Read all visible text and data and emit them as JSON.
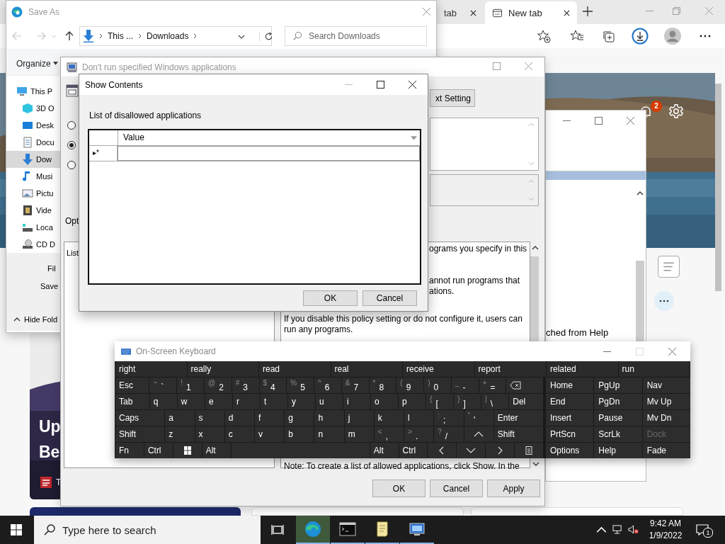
{
  "browser": {
    "tabs": [
      {
        "label": "tab",
        "selected": false
      },
      {
        "label": "New tab",
        "selected": true
      }
    ],
    "notification_count": "2",
    "headline_lines": [
      "Up",
      "Be"
    ],
    "source_letter": "T"
  },
  "help_window": {
    "text": "ched from Help"
  },
  "save_as": {
    "title": "Save As",
    "path": [
      "This ...",
      "Downloads"
    ],
    "search": {
      "placeholder": "Search Downloads"
    },
    "organize": "Organize",
    "nav_items": [
      {
        "label": "This P",
        "kind": "pc",
        "selected": false,
        "children": [
          {
            "label": "3D O",
            "kind": "objects",
            "selected": false
          },
          {
            "label": "Desk",
            "kind": "desktop",
            "selected": false
          },
          {
            "label": "Docu",
            "kind": "documents",
            "selected": false
          },
          {
            "label": "Dow",
            "kind": "downloads",
            "selected": true
          },
          {
            "label": "Musi",
            "kind": "music",
            "selected": false
          },
          {
            "label": "Pictu",
            "kind": "pictures",
            "selected": false
          },
          {
            "label": "Vide",
            "kind": "videos",
            "selected": false
          },
          {
            "label": "Loca",
            "kind": "disk",
            "selected": false
          },
          {
            "label": "CD D",
            "kind": "cd",
            "selected": false
          }
        ]
      }
    ],
    "file_name_label": "Fil",
    "save_type_label": "Save",
    "hide_folders": "Hide Fold"
  },
  "policy": {
    "title": "Don't run specified Windows applications",
    "next_button": "xt Setting",
    "options": [
      {
        "selected": false
      },
      {
        "selected": true
      },
      {
        "selected": false
      }
    ],
    "options_label": "Opt",
    "list_label": "List",
    "help_lines": [
      {
        "kind": "fragment",
        "text": "ograms you specify in this"
      },
      {
        "kind": "fragment",
        "text": "annot run programs that"
      },
      {
        "kind": "fragment",
        "text": "ations."
      },
      {
        "kind": "line",
        "text": "If you disable this policy setting or do not configure it, users can"
      },
      {
        "kind": "line",
        "text": "run any programs."
      },
      {
        "kind": "line",
        "text": "Note: To create a list of allowed applications, click Show.  In the"
      }
    ],
    "buttons": [
      "OK",
      "Cancel",
      "Apply"
    ]
  },
  "show_contents": {
    "title": "Show Contents",
    "label": "List of disallowed applications",
    "column": "Value",
    "new_row_marker": "▸*",
    "buttons": [
      "OK",
      "Cancel"
    ]
  },
  "keyboard": {
    "title": "On-Screen Keyboard",
    "predictions": [
      "right",
      "really",
      "read",
      "real",
      "receive",
      "report",
      "related",
      "run"
    ],
    "rows": [
      [
        {
          "kind": "wide",
          "label": "Esc"
        },
        {
          "kind": "key",
          "top": "~",
          "label": "`"
        },
        {
          "kind": "key",
          "top": "!",
          "label": "1"
        },
        {
          "kind": "key",
          "top": "@",
          "label": "2"
        },
        {
          "kind": "key",
          "top": "#",
          "label": "3"
        },
        {
          "kind": "key",
          "top": "$",
          "label": "4"
        },
        {
          "kind": "key",
          "top": "%",
          "label": "5"
        },
        {
          "kind": "key",
          "top": "^",
          "label": "6"
        },
        {
          "kind": "key",
          "top": "&",
          "label": "7"
        },
        {
          "kind": "key",
          "top": "*",
          "label": "8"
        },
        {
          "kind": "key",
          "top": "(",
          "label": "9"
        },
        {
          "kind": "key",
          "top": ")",
          "label": "0"
        },
        {
          "kind": "key",
          "top": "_",
          "label": "-"
        },
        {
          "kind": "key",
          "top": "+",
          "label": "="
        },
        {
          "kind": "backspace"
        }
      ],
      [
        {
          "kind": "wide",
          "label": "Tab"
        },
        {
          "kind": "key",
          "label": "q"
        },
        {
          "kind": "key",
          "label": "w"
        },
        {
          "kind": "key",
          "label": "e"
        },
        {
          "kind": "key",
          "label": "r"
        },
        {
          "kind": "key",
          "label": "t"
        },
        {
          "kind": "key",
          "label": "y"
        },
        {
          "kind": "key",
          "label": "u"
        },
        {
          "kind": "key",
          "label": "i"
        },
        {
          "kind": "key",
          "label": "o"
        },
        {
          "kind": "key",
          "label": "p"
        },
        {
          "kind": "key",
          "top": "{",
          "label": "["
        },
        {
          "kind": "key",
          "top": "}",
          "label": "]"
        },
        {
          "kind": "key",
          "top": "|",
          "label": "\\"
        },
        {
          "kind": "wide",
          "label": "Del"
        }
      ],
      [
        {
          "kind": "xwide",
          "label": "Caps"
        },
        {
          "kind": "key",
          "label": "a"
        },
        {
          "kind": "key",
          "label": "s"
        },
        {
          "kind": "key",
          "label": "d"
        },
        {
          "kind": "key",
          "label": "f"
        },
        {
          "kind": "key",
          "label": "g"
        },
        {
          "kind": "key",
          "label": "h"
        },
        {
          "kind": "key",
          "label": "j"
        },
        {
          "kind": "key",
          "label": "k"
        },
        {
          "kind": "key",
          "label": "l"
        },
        {
          "kind": "key",
          "top": ":",
          "label": ";"
        },
        {
          "kind": "key",
          "top": "\"",
          "label": "'"
        },
        {
          "kind": "xwide",
          "label": "Enter"
        }
      ],
      [
        {
          "kind": "xwide",
          "label": "Shift"
        },
        {
          "kind": "key",
          "label": "z"
        },
        {
          "kind": "key",
          "label": "x"
        },
        {
          "kind": "key",
          "label": "c"
        },
        {
          "kind": "key",
          "label": "v"
        },
        {
          "kind": "key",
          "label": "b"
        },
        {
          "kind": "key",
          "label": "n"
        },
        {
          "kind": "key",
          "label": "m"
        },
        {
          "kind": "key",
          "top": "<",
          "label": ","
        },
        {
          "kind": "key",
          "top": ">",
          "label": "."
        },
        {
          "kind": "key",
          "top": "?",
          "label": "/"
        },
        {
          "kind": "up"
        },
        {
          "kind": "xwide",
          "label": "Shift"
        }
      ],
      [
        {
          "kind": "key",
          "label": "Fn"
        },
        {
          "kind": "key",
          "label": "Ctrl"
        },
        {
          "kind": "windows"
        },
        {
          "kind": "key",
          "label": "Alt"
        },
        {
          "kind": "space"
        },
        {
          "kind": "key",
          "label": "Alt"
        },
        {
          "kind": "key",
          "label": "Ctrl"
        },
        {
          "kind": "left"
        },
        {
          "kind": "down"
        },
        {
          "kind": "right"
        },
        {
          "kind": "menu"
        }
      ]
    ],
    "nav_keys": [
      {
        "label": "Home",
        "disabled": false
      },
      {
        "label": "PgUp",
        "disabled": false
      },
      {
        "label": "Nav",
        "disabled": false
      },
      {
        "label": "End",
        "disabled": false
      },
      {
        "label": "PgDn",
        "disabled": false
      },
      {
        "label": "Mv Up",
        "disabled": false
      },
      {
        "label": "Insert",
        "disabled": false
      },
      {
        "label": "Pause",
        "disabled": false
      },
      {
        "label": "Mv Dn",
        "disabled": false
      },
      {
        "label": "PrtScn",
        "disabled": false
      },
      {
        "label": "ScrLk",
        "disabled": false
      },
      {
        "label": "Dock",
        "disabled": true
      },
      {
        "label": "Options",
        "disabled": false
      },
      {
        "label": "Help",
        "disabled": false
      },
      {
        "label": "Fade",
        "disabled": false
      }
    ]
  },
  "taskbar": {
    "search_placeholder": "Type here to search",
    "apps": [
      {
        "kind": "edge",
        "selected": true
      },
      {
        "kind": "terminal",
        "selected": false
      },
      {
        "kind": "notepad",
        "selected": false
      },
      {
        "kind": "remote",
        "selected": false
      }
    ],
    "time": "9:42 AM",
    "date": "1/9/2022",
    "notifications": "1"
  }
}
